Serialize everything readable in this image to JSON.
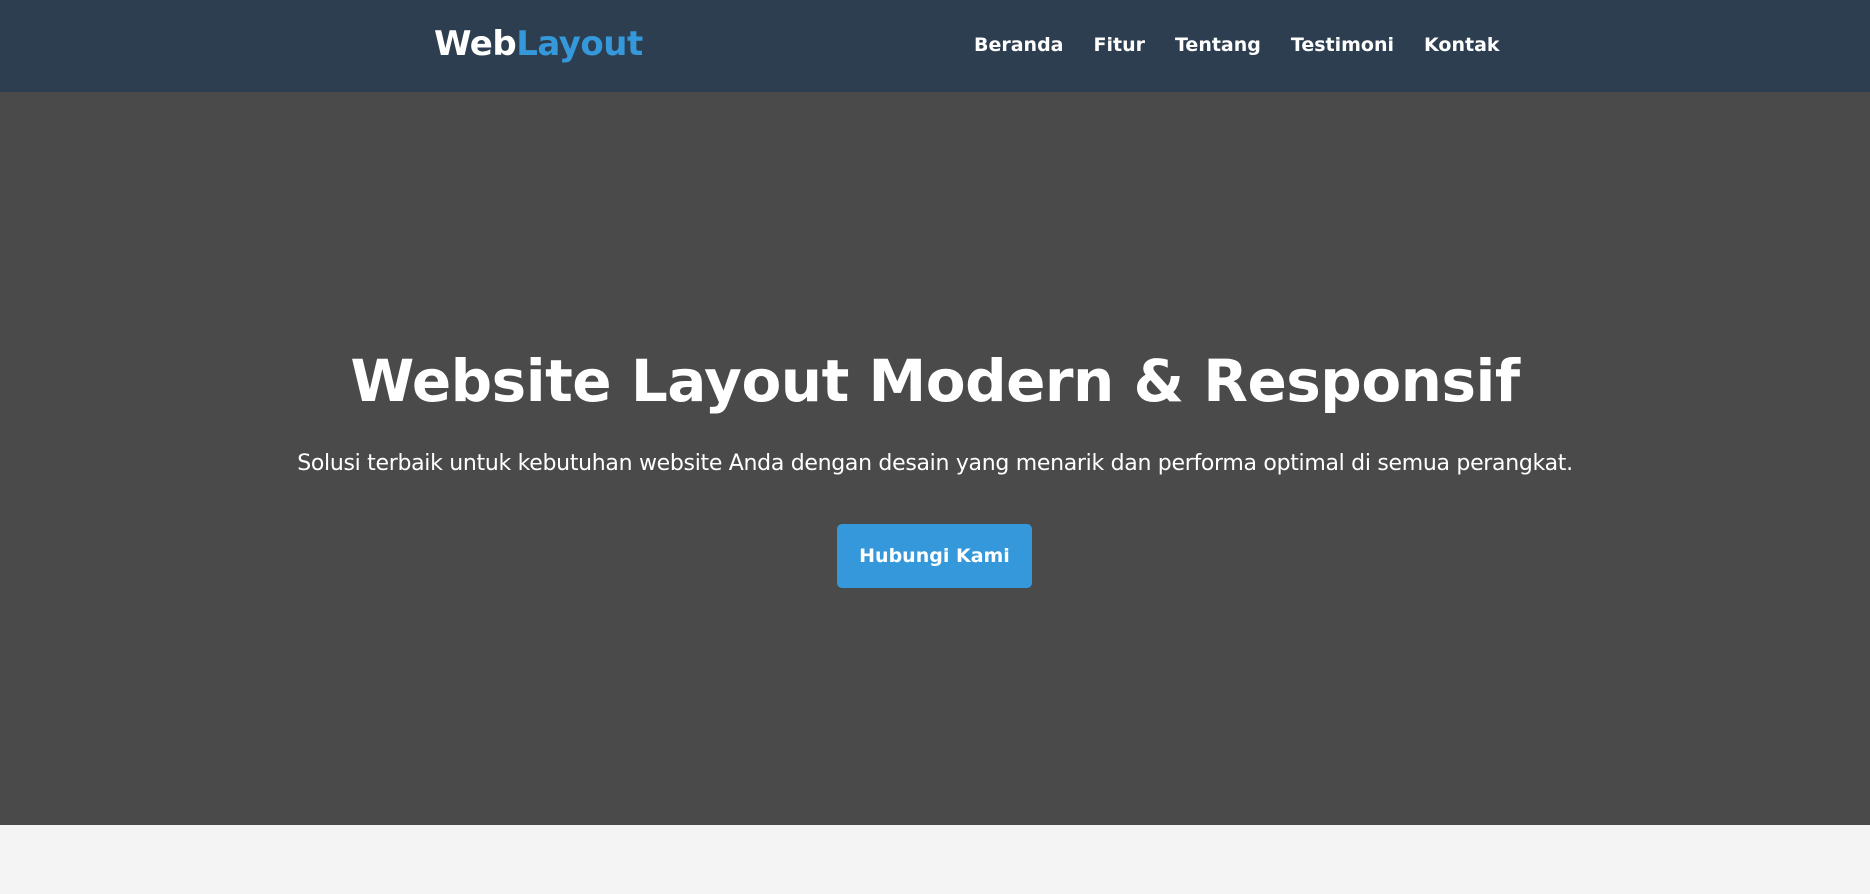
{
  "header": {
    "logo": {
      "part_1": "Web",
      "part_2": "Layout"
    },
    "nav": [
      {
        "label": "Beranda"
      },
      {
        "label": "Fitur"
      },
      {
        "label": "Tentang"
      },
      {
        "label": "Testimoni"
      },
      {
        "label": "Kontak"
      }
    ]
  },
  "hero": {
    "title": "Website Layout Modern & Responsif",
    "subtitle": "Solusi terbaik untuk kebutuhan website Anda dengan desain yang menarik dan performa optimal di semua perangkat.",
    "cta_label": "Hubungi Kami"
  },
  "colors": {
    "header_background": "#2d3e50",
    "hero_background": "#4a4a4a",
    "accent": "#3498db",
    "page_background": "#f4f4f4",
    "text": "#ffffff"
  }
}
